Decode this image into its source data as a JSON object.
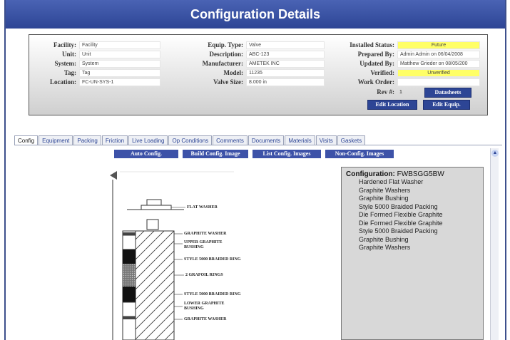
{
  "header": {
    "title": "Configuration Details"
  },
  "info": {
    "facility": {
      "label": "Facility:",
      "value": "Facility"
    },
    "unit": {
      "label": "Unit:",
      "value": "Unit"
    },
    "system": {
      "label": "System:",
      "value": "System"
    },
    "tag": {
      "label": "Tag:",
      "value": "Tag"
    },
    "location": {
      "label": "Location:",
      "value": "FC-UN-SYS-1"
    },
    "equip_type": {
      "label": "Equip. Type:",
      "value": "Valve"
    },
    "description": {
      "label": "Description:",
      "value": "ABC-123"
    },
    "manufacturer": {
      "label": "Manufacturer:",
      "value": "AMETEK INC"
    },
    "model": {
      "label": "Model:",
      "value": "11235"
    },
    "valve_size": {
      "label": "Valve Size:",
      "value": "8.000 in"
    },
    "installed_status": {
      "label": "Installed Status:",
      "value": "Future"
    },
    "prepared_by": {
      "label": "Prepared By:",
      "value": "Admin Admin on 06/04/2008"
    },
    "updated_by": {
      "label": "Updated By:",
      "value": "Matthew Grieder on 08/05/200"
    },
    "verified": {
      "label": "Verified:",
      "value": "Unverified"
    },
    "work_order": {
      "label": "Work Order:",
      "value": ""
    },
    "rev": {
      "label": "Rev #:",
      "value": "1"
    },
    "highlight_color": "#ffff66"
  },
  "buttons": {
    "datasheets": "Datasheets",
    "edit_location": "Edit Location",
    "edit_equip": "Edit Equip."
  },
  "tabs": [
    {
      "label": "Config",
      "active": true
    },
    {
      "label": "Equipment"
    },
    {
      "label": "Packing"
    },
    {
      "label": "Friction"
    },
    {
      "label": "Live Loading"
    },
    {
      "label": "Op Conditions"
    },
    {
      "label": "Comments"
    },
    {
      "label": "Documents"
    },
    {
      "label": "Materials"
    },
    {
      "label": "Visits"
    },
    {
      "label": "Gaskets"
    }
  ],
  "actions": {
    "auto_config": "Auto Config.",
    "build_image": "Build Config. Image",
    "list_images": "List Config. Images",
    "non_config": "Non-Config. Images"
  },
  "diagram_labels": {
    "flat_washer": "FLAT WASHER",
    "graphite_washer_top": "GRAPHITE WASHER",
    "upper_bushing": "UPPER GRAPHITE BUSHING",
    "braided_top": "STYLE 5000 BRAIDED RING",
    "grafoil": "2 GRAFOIL RINGS",
    "braided_bottom": "STYLE 5000 BRAIDED RING",
    "lower_bushing": "LOWER GRAPHITE BUSHING",
    "graphite_washer_bottom": "GRAPHITE WASHER"
  },
  "configuration": {
    "label": "Configuration:",
    "code": "FWBSGG5BW",
    "items": [
      "Hardened Flat Washer",
      "Graphite Washers",
      "Graphite Bushing",
      "Style 5000 Braided Packing",
      "Die Formed Flexible Graphite",
      "Die Formed Flexible Graphite",
      "Style 5000 Braided Packing",
      "Graphite Bushing",
      "Graphite Washers"
    ]
  },
  "icons": {
    "scroll_up": "chevron-up-icon"
  }
}
